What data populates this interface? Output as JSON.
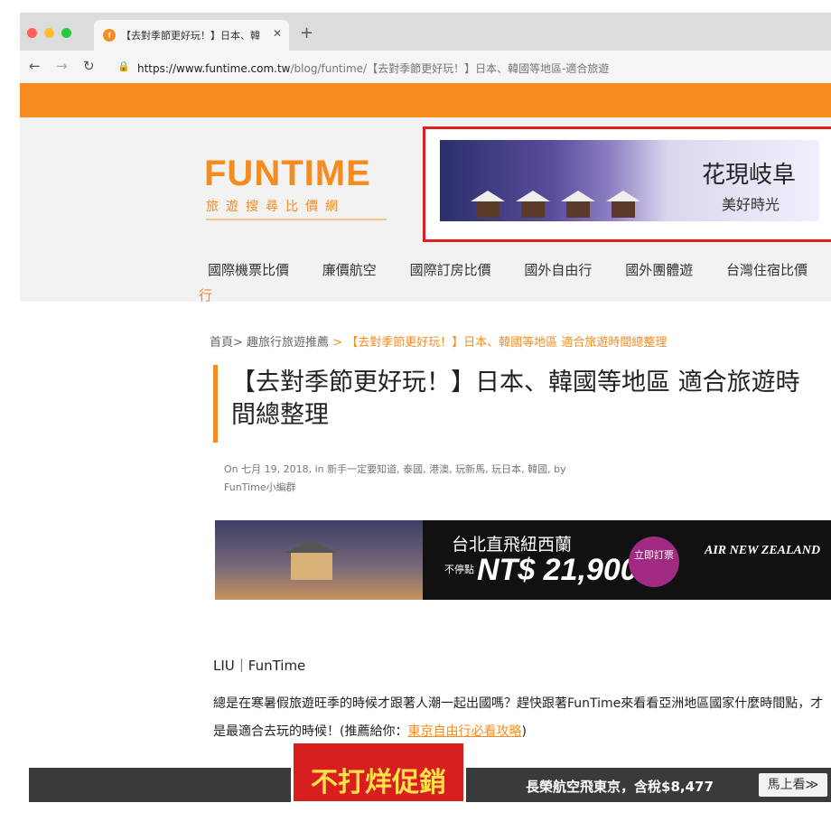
{
  "browser": {
    "tab_title": "【去對季節更好玩！】日本、韓",
    "tab_favicon_letter": "f",
    "url_host": "https://www.funtime.com.tw",
    "url_path": "/blog/funtime/【去對季節更好玩！】日本、韓國等地區-適合旅遊",
    "colors": {
      "red": "#ff5f57",
      "yellow": "#febc2e",
      "green": "#28c840"
    }
  },
  "header": {
    "logo": "FUNTIME",
    "logo_sub": "旅遊搜尋比價網",
    "ad_line1": "花現岐阜",
    "ad_line2": "美好時光",
    "nav": [
      "國際機票比價",
      "廉價航空",
      "國際訂房比價",
      "國外自由行",
      "國外團體遊",
      "台灣住宿比價",
      "國"
    ],
    "nav_wrap": "行",
    "accent": "#f68b1f"
  },
  "article": {
    "breadcrumb_home": "首頁>",
    "breadcrumb_section": "趣旅行旅遊推薦",
    "breadcrumb_sep": ">",
    "breadcrumb_current": "【去對季節更好玩！】日本、韓國等地區 適合旅遊時間總整理",
    "title": "【去對季節更好玩！】日本、韓國等地區 適合旅遊時間總整理",
    "meta": "On 七月 19, 2018, in 新手一定要知道, 泰國, 港澳, 玩新馬, 玩日本, 韓國, by FunTime小編群",
    "author": "LIU｜FunTime",
    "body": "總是在寒暑假旅遊旺季的時候才跟著人潮一起出國嗎？趕快跟著FunTime來看看亞洲地區國家什麼時間點，才是最適合去玩的時候！(推薦給你：",
    "body_link": "東京自由行必看攻略",
    "body_end": ")"
  },
  "promo": {
    "route": "台北直飛紐西蘭",
    "nonstop": "不停點",
    "price": "NT$ 21,900",
    "button": "立即訂票",
    "airline": "AIR NEW ZEALAND"
  },
  "bottom_bar": {
    "ad_text": "不打烊促銷",
    "offer": "長榮航空飛東京，含稅$8,477",
    "button": "馬上看≫"
  }
}
